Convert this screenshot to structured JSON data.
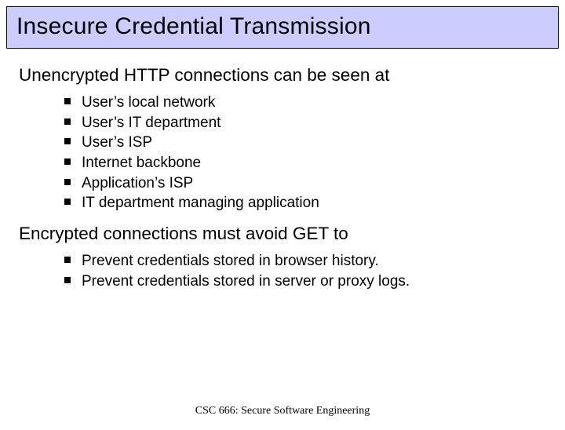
{
  "title": "Insecure Credential Transmission",
  "section1": {
    "heading": "Unencrypted HTTP connections can be seen at",
    "items": [
      "User’s local network",
      "User’s IT department",
      "User’s ISP",
      "Internet backbone",
      "Application’s ISP",
      "IT department managing application"
    ]
  },
  "section2": {
    "heading": "Encrypted connections must avoid GET to",
    "items": [
      "Prevent credentials stored in browser history.",
      "Prevent credentials stored in server or proxy logs."
    ]
  },
  "footer": "CSC 666: Secure Software Engineering"
}
